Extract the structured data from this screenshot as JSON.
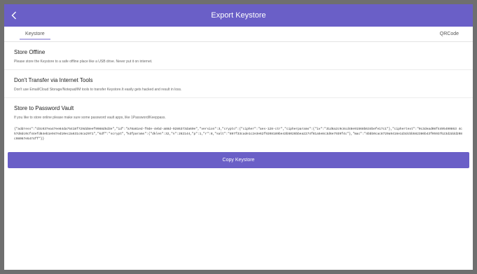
{
  "header": {
    "title": "Export Keystore"
  },
  "tabs": {
    "keystore": "Keystore",
    "qrcode": "QRCode"
  },
  "sections": [
    {
      "title": "Store Offline",
      "desc": "Please store the Keystore to a safe offline place like a USB drive. Never put it on internet."
    },
    {
      "title": "Don't Transfer via Internet Tools",
      "desc": "Don't use Email/Cloud Storage/Notepad/IM tools to transfer Keystore.It easily gets hacked and result in loss."
    },
    {
      "title": "Store to Password Vault",
      "desc": "If you like to store online please make sure some password vault apps, like 1Password/Keeppass."
    }
  ],
  "keystore_json": "{\"address\":\"d3c037ea47ee84da75418f729dd8eef9988d5d3e\",\"id\":\"a78a61ed-f9de-4ebd-a88d-9286373da69e\",\"version\":3,\"crypto\":{\"cipher\":\"aes-128-ctr\",\"cipherparams\":{\"iv\":\"31d6a2c9c8cd48e91568b634befe17c1\"},\"ciphertext\":\"0c3dead08f4495490863 4c57d8dc0cf44efd84eb1e947ed10ec2a631c6ca2971\",\"kdf\":\"scrypt\",\"kdfparams\":{\"dklen\":32,\"n\":262144,\"p\":1,\"r\":8,\"salt\":\"897f33cade1c2e3e62f9208189be43b5026bbea2274f81a5e8c3d6e7939f4c\"},\"mac\":\"4bbb0cac8720a9416e1d3dcbb582386b43f05937b23d2ddd208c98067e5474ff\"}}",
  "actions": {
    "copy_label": "Copy Keystore"
  }
}
